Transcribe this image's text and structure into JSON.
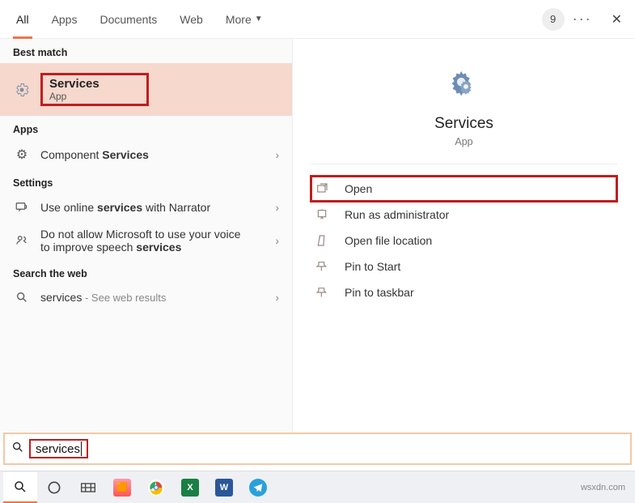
{
  "tabs": {
    "all": "All",
    "apps": "Apps",
    "documents": "Documents",
    "web": "Web",
    "more": "More"
  },
  "header": {
    "badge": "9"
  },
  "sections": {
    "best_match": "Best match",
    "apps": "Apps",
    "settings": "Settings",
    "search_web": "Search the web"
  },
  "best_match": {
    "title": "Services",
    "sub": "App"
  },
  "results": {
    "component_pre": "Component ",
    "component_bold": "Services",
    "narrator_pre": "Use online ",
    "narrator_bold": "services",
    "narrator_post": " with Narrator",
    "speech_pre": "Do not allow Microsoft to use your voice to improve speech ",
    "speech_bold": "services",
    "web_term": "services",
    "web_suffix": " - See web results"
  },
  "preview": {
    "title": "Services",
    "sub": "App"
  },
  "actions": {
    "open": "Open",
    "admin": "Run as administrator",
    "location": "Open file location",
    "pin_start": "Pin to Start",
    "pin_taskbar": "Pin to taskbar"
  },
  "search": {
    "value": "services"
  },
  "watermark": "wsxdn.com"
}
